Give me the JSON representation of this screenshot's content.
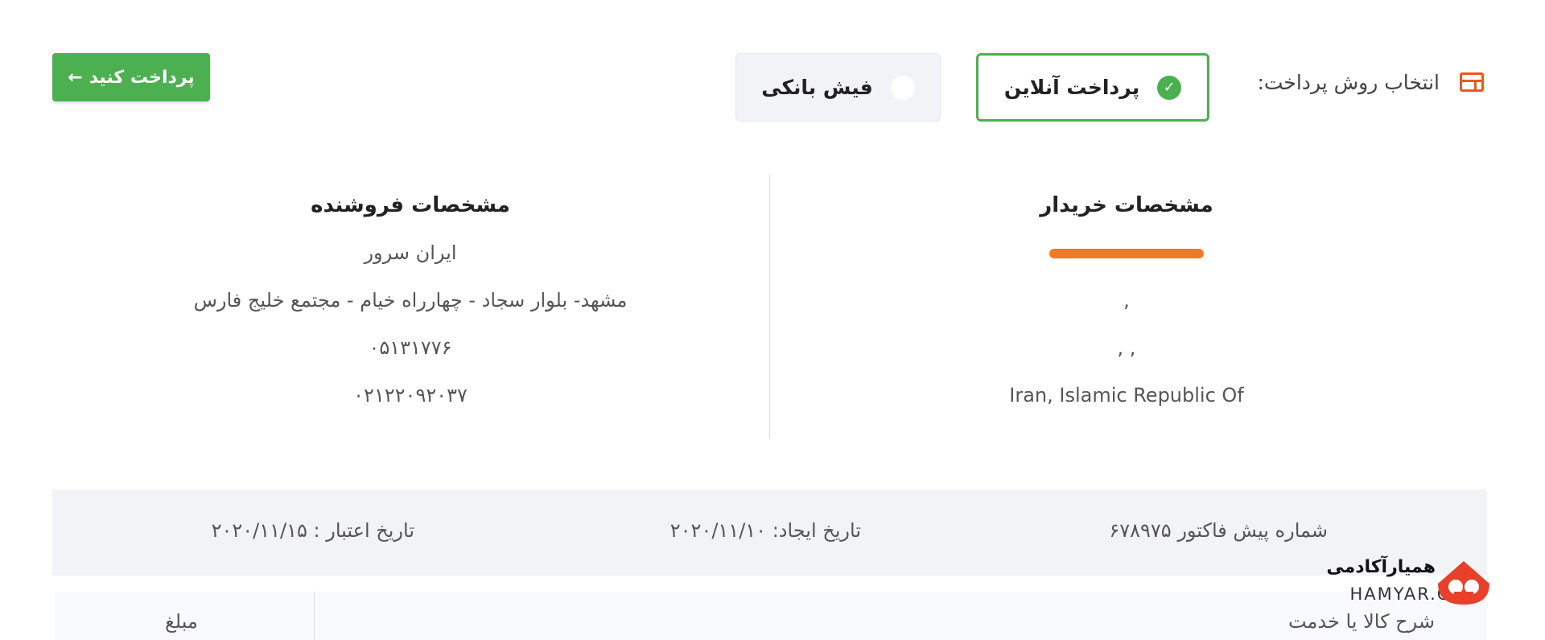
{
  "payment_method": {
    "label": "انتخاب روش پرداخت:",
    "options": [
      {
        "label": "پرداخت آنلاین",
        "selected": true
      },
      {
        "label": "فیش بانکی",
        "selected": false
      }
    ],
    "pay_button": "پرداخت کنید",
    "pay_button_arrow": "←"
  },
  "buyer": {
    "title": "مشخصات خریدار",
    "name_redacted": true,
    "line2": ",",
    "line3": ", ,",
    "country": "Iran, Islamic Republic Of"
  },
  "seller": {
    "title": "مشخصات فروشنده",
    "name": "ایران سرور",
    "address": "مشهد- بلوار سجاد - چهارراه خیام - مجتمع خلیج فارس",
    "phone1": "۰۵۱۳۱۷۷۶",
    "phone2": "۰۲۱۲۲۰۹۲۰۳۷"
  },
  "invoice": {
    "number": "شماره پیش فاکتور ۶۷۸۹۷۵",
    "created": "تاریخ ایجاد: ۲۰۲۰/۱۱/۱۰",
    "valid": "تاریخ اعتبار : ۲۰۲۰/۱۱/۱۵"
  },
  "table": {
    "columns": [
      "شرح کالا یا خدمت",
      "مبلغ"
    ]
  },
  "watermark": {
    "name_fa": "همیارآکادمی",
    "name_en": "HAMYAR.CO"
  },
  "colors": {
    "accent_green": "#4caf50",
    "accent_orange": "#e85a1c",
    "panel_bg": "#f1f3f7"
  },
  "icons": {
    "method": "payment-layout-icon",
    "selected_option": "check-circle-icon",
    "unselected_option": "radio-empty-icon",
    "watermark": "hamyar-logo-icon"
  }
}
